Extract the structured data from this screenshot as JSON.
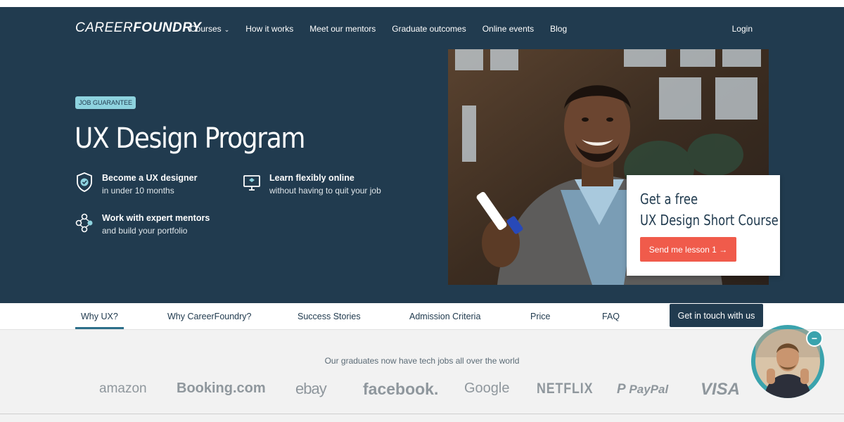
{
  "header": {
    "logo_part1": "CAREER",
    "logo_part2": "FOUNDRY",
    "nav": [
      "Courses",
      "How it works",
      "Meet our mentors",
      "Graduate outcomes",
      "Online events",
      "Blog"
    ],
    "login": "Login"
  },
  "hero": {
    "badge": "JOB GUARANTEE",
    "title": "UX Design Program",
    "features": [
      {
        "icon": "shield-check-icon",
        "line1": "Become a UX designer",
        "line2": "in under 10 months"
      },
      {
        "icon": "monitor-icon",
        "line1": "Learn flexibly online",
        "line2": "without having to quit your job"
      },
      {
        "icon": "mentors-network-icon",
        "line1": "Work with expert mentors",
        "line2": "and build your portfolio"
      }
    ],
    "card": {
      "line1": "Get a free",
      "line2": "UX Design Short Course",
      "button": "Send me lesson 1 →"
    }
  },
  "subnav": {
    "tabs": [
      "Why UX?",
      "Why CareerFoundry?",
      "Success Stories",
      "Admission Criteria",
      "Price",
      "FAQ"
    ],
    "active": "Why UX?",
    "cta": "Get in touch with us"
  },
  "graduates": {
    "text": "Our graduates now have tech jobs all over the world",
    "brands": [
      "amazon",
      "Booking.com",
      "ebay",
      "facebook.",
      "Google",
      "NETFLIX",
      "PayPal",
      "VISA"
    ]
  },
  "colors": {
    "hero_bg": "#213b4f",
    "accent_cta": "#f05b4b",
    "badge": "#8ed3df",
    "tab_underline": "#2c6f8a",
    "video_ring": "#3aa3ad"
  },
  "video_widget": {
    "close_label": "−"
  }
}
